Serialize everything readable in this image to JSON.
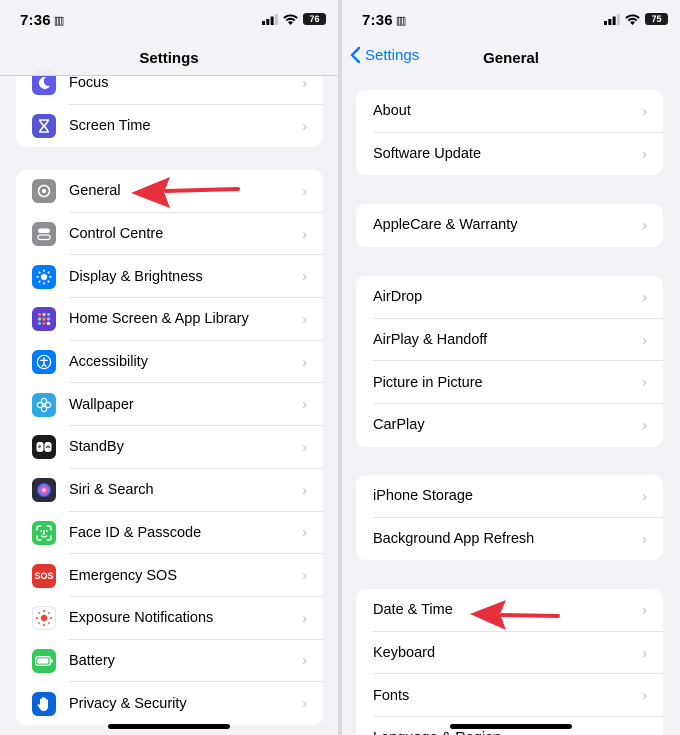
{
  "status": {
    "time": "7:36",
    "sim": "▥"
  },
  "left": {
    "title": "Settings",
    "battery": "76",
    "group_top": [
      {
        "label": "Focus",
        "icon": "moon-icon",
        "color": "#5e5ce6"
      },
      {
        "label": "Screen Time",
        "icon": "hourglass-icon",
        "color": "#5856d6"
      }
    ],
    "group_main": [
      {
        "label": "General",
        "icon": "gear-icon",
        "color": "#8e8e93"
      },
      {
        "label": "Control Centre",
        "icon": "toggles-icon",
        "color": "#8e8e93"
      },
      {
        "label": "Display & Brightness",
        "icon": "sun-icon",
        "color": "#007aff"
      },
      {
        "label": "Home Screen & App Library",
        "icon": "grid-icon",
        "color": "#5e3fcf"
      },
      {
        "label": "Accessibility",
        "icon": "accessibility-icon",
        "color": "#007aff"
      },
      {
        "label": "Wallpaper",
        "icon": "flower-icon",
        "color": "#30a8e6"
      },
      {
        "label": "StandBy",
        "icon": "standby-icon",
        "color": "#1c1c1e"
      },
      {
        "label": "Siri & Search",
        "icon": "siri-icon",
        "color": "#2b2b3a"
      },
      {
        "label": "Face ID & Passcode",
        "icon": "face-id-icon",
        "color": "#34c759"
      },
      {
        "label": "Emergency SOS",
        "icon": "sos-icon",
        "color": "#e0382f",
        "text": "SOS"
      },
      {
        "label": "Exposure Notifications",
        "icon": "exposure-icon",
        "color": "#ffffff"
      },
      {
        "label": "Battery",
        "icon": "battery-icon",
        "color": "#34c759"
      },
      {
        "label": "Privacy & Security",
        "icon": "hand-icon",
        "color": "#0a64d8"
      }
    ]
  },
  "right": {
    "back_label": "Settings",
    "title": "General",
    "battery": "75",
    "groups": [
      [
        "About",
        "Software Update"
      ],
      [
        "AppleCare & Warranty"
      ],
      [
        "AirDrop",
        "AirPlay & Handoff",
        "Picture in Picture",
        "CarPlay"
      ],
      [
        "iPhone Storage",
        "Background App Refresh"
      ],
      [
        "Date & Time",
        "Keyboard",
        "Fonts",
        "Language & Region"
      ]
    ]
  },
  "colors": {
    "accent": "#007aff",
    "arrow": "#e8303c"
  }
}
